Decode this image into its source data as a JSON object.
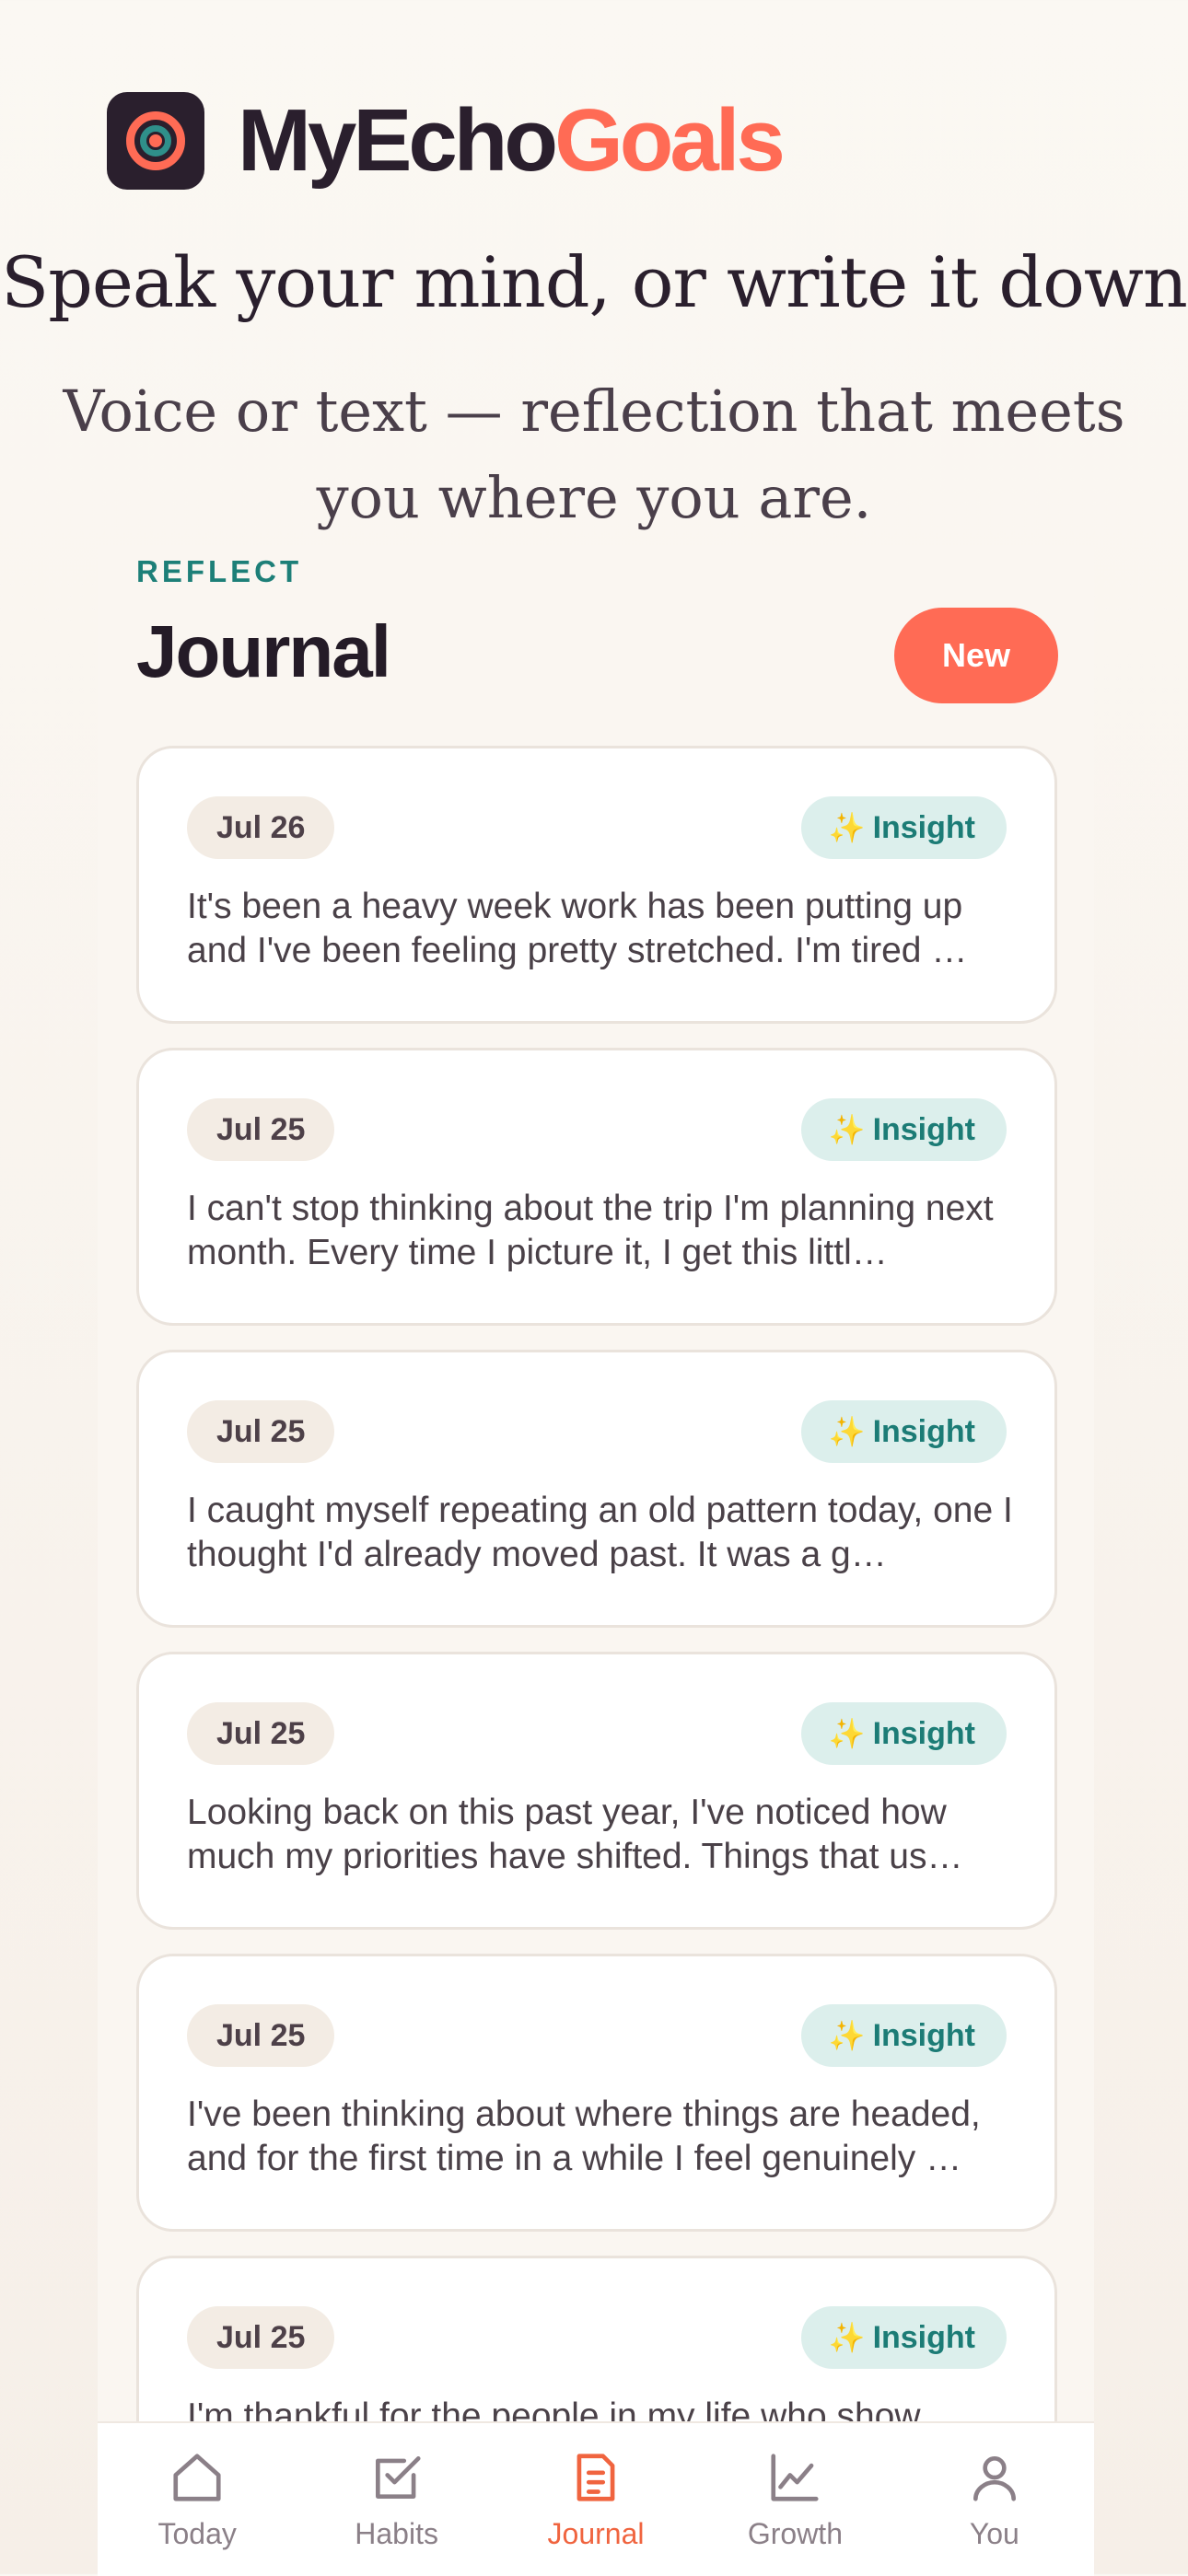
{
  "brand": {
    "name_part1": "MyEcho",
    "name_part2": "Goals",
    "logo_icon": "target-logo-icon"
  },
  "hero": {
    "headline": "Speak your mind, or write it down",
    "subhead": "Voice or text — reflection that meets you where you are."
  },
  "screen": {
    "eyebrow": "REFLECT",
    "title": "Journal",
    "new_button": "New"
  },
  "entries": [
    {
      "date": "Jul 26",
      "badge": "Insight",
      "badge_icon": "sparkles-icon",
      "text": "It's been a heavy week work has been putting up and I've been feeling pretty stretched. I'm tired …"
    },
    {
      "date": "Jul 25",
      "badge": "Insight",
      "badge_icon": "sparkles-icon",
      "text": "I can't stop thinking about the trip I'm planning next month. Every time I picture it, I get this littl…"
    },
    {
      "date": "Jul 25",
      "badge": "Insight",
      "badge_icon": "sparkles-icon",
      "text": "I caught myself repeating an old pattern today, one I thought I'd already moved past. It was a g…"
    },
    {
      "date": "Jul 25",
      "badge": "Insight",
      "badge_icon": "sparkles-icon",
      "text": "Looking back on this past year, I've noticed how much my priorities have shifted. Things that us…"
    },
    {
      "date": "Jul 25",
      "badge": "Insight",
      "badge_icon": "sparkles-icon",
      "text": "I've been thinking about where things are headed, and for the first time in a while I feel genuinely …"
    },
    {
      "date": "Jul 25",
      "badge": "Insight",
      "badge_icon": "sparkles-icon",
      "text": "I'm thankful for the people in my life who show…"
    }
  ],
  "tabs": [
    {
      "label": "Today",
      "icon": "home-icon",
      "active": false
    },
    {
      "label": "Habits",
      "icon": "checkbox-icon",
      "active": false
    },
    {
      "label": "Journal",
      "icon": "journal-icon",
      "active": true
    },
    {
      "label": "Growth",
      "icon": "chart-icon",
      "active": false
    },
    {
      "label": "You",
      "icon": "person-icon",
      "active": false
    }
  ],
  "colors": {
    "accent": "#ff6b55",
    "teal": "#1d7f78",
    "ink": "#2a1f2d",
    "inactive": "#8b8088"
  }
}
